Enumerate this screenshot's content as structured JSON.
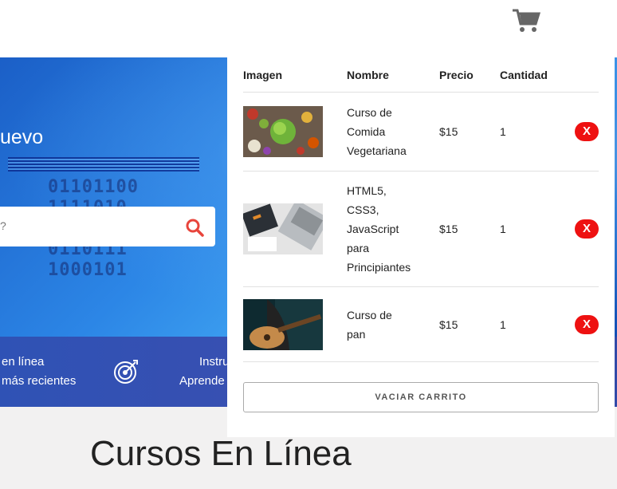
{
  "header": {
    "cart_icon": "cart-icon"
  },
  "hero": {
    "title_fragment": "uevo",
    "search_placeholder": "?",
    "search_icon": "search-icon"
  },
  "features": {
    "left_line1": "en línea",
    "left_line2": "más recientes",
    "right_line1": "Instru",
    "right_line2": "Aprende",
    "target_icon": "target-icon"
  },
  "page": {
    "heading": "Cursos En Línea"
  },
  "cart": {
    "columns": [
      "Imagen",
      "Nombre",
      "Precio",
      "Cantidad"
    ],
    "items": [
      {
        "name_lines": [
          "Curso de",
          "Comida",
          "Vegetariana"
        ],
        "price": "$15",
        "qty": "1",
        "remove": "X"
      },
      {
        "name_lines": [
          "HTML5,",
          "CSS3,",
          "JavaScript",
          "para",
          "Principiantes"
        ],
        "price": "$15",
        "qty": "1",
        "remove": "X"
      },
      {
        "name_lines": [
          "Curso de",
          "pan"
        ],
        "price": "$15",
        "qty": "1",
        "remove": "X"
      }
    ],
    "empty_label": "VACIAR CARRITO"
  },
  "colors": {
    "remove": "#ee1111",
    "banner": "#3a4fb0",
    "hero": "#2c86e6"
  }
}
